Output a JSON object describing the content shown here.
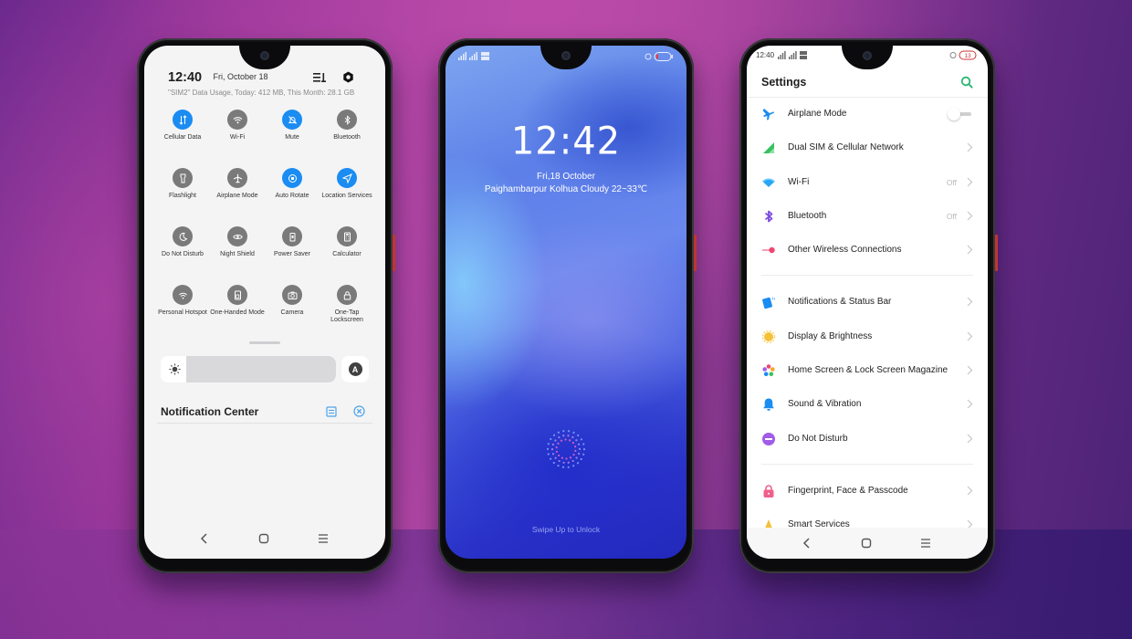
{
  "quick_settings": {
    "time": "12:40",
    "date": "Fri, October 18",
    "data_usage": "\"SIM2\" Data Usage, Today: 412 MB, This Month: 28.1 GB",
    "tiles": [
      {
        "label": "Cellular Data",
        "icon": "cellular-data-icon",
        "active": true
      },
      {
        "label": "Wi-Fi",
        "icon": "wifi-icon",
        "active": false
      },
      {
        "label": "Mute",
        "icon": "mute-icon",
        "active": true
      },
      {
        "label": "Bluetooth",
        "icon": "bluetooth-icon",
        "active": false
      },
      {
        "label": "Flashlight",
        "icon": "flashlight-icon",
        "active": false
      },
      {
        "label": "Airplane Mode",
        "icon": "airplane-icon",
        "active": false
      },
      {
        "label": "Auto Rotate",
        "icon": "auto-rotate-icon",
        "active": true
      },
      {
        "label": "Location Services",
        "icon": "location-icon",
        "active": true
      },
      {
        "label": "Do Not Disturb",
        "icon": "moon-icon",
        "active": false
      },
      {
        "label": "Night Shield",
        "icon": "eye-icon",
        "active": false
      },
      {
        "label": "Power Saver",
        "icon": "battery-icon",
        "active": false
      },
      {
        "label": "Calculator",
        "icon": "calculator-icon",
        "active": false
      },
      {
        "label": "Personal Hotspot",
        "icon": "hotspot-icon",
        "active": false
      },
      {
        "label": "One-Handed Mode",
        "icon": "one-handed-icon",
        "active": false
      },
      {
        "label": "Camera",
        "icon": "camera-icon",
        "active": false
      },
      {
        "label": "One-Tap Lockscreen",
        "icon": "lock-icon",
        "active": false
      }
    ],
    "brightness_auto_label": "A",
    "notification_center_title": "Notification Center"
  },
  "lock_screen": {
    "time": "12:42",
    "date": "Fri,18 October",
    "weather": "Paighambarpur Kolhua Cloudy 22~33℃",
    "unlock_hint": "Swipe Up to Unlock"
  },
  "settings": {
    "status_time": "12:40",
    "battery_level": "13",
    "title": "Settings",
    "groups": [
      [
        {
          "label": "Airplane Mode",
          "icon": "airplane-icon",
          "type": "toggle",
          "on": false
        },
        {
          "label": "Dual SIM & Cellular Network",
          "icon": "cellular-signal-icon",
          "type": "link"
        },
        {
          "label": "Wi-Fi",
          "icon": "wifi-icon",
          "type": "link",
          "value": "Off"
        },
        {
          "label": "Bluetooth",
          "icon": "bluetooth-icon",
          "type": "link",
          "value": "Off"
        },
        {
          "label": "Other Wireless Connections",
          "icon": "wireless-connections-icon",
          "type": "link"
        }
      ],
      [
        {
          "label": "Notifications & Status Bar",
          "icon": "notifications-icon",
          "type": "link"
        },
        {
          "label": "Display & Brightness",
          "icon": "sun-icon",
          "type": "link"
        },
        {
          "label": "Home Screen & Lock Screen Magazine",
          "icon": "flower-icon",
          "type": "link"
        },
        {
          "label": "Sound & Vibration",
          "icon": "bell-icon",
          "type": "link"
        },
        {
          "label": "Do Not Disturb",
          "icon": "do-not-disturb-icon",
          "type": "link"
        }
      ],
      [
        {
          "label": "Fingerprint, Face & Passcode",
          "icon": "lock-icon",
          "type": "link"
        },
        {
          "label": "Smart Services",
          "icon": "smart-services-icon",
          "type": "link"
        }
      ]
    ]
  },
  "colors": {
    "accent_blue": "#1a8cf2",
    "tile_inactive": "#7a7a7a",
    "settings_search": "#2bb673"
  }
}
